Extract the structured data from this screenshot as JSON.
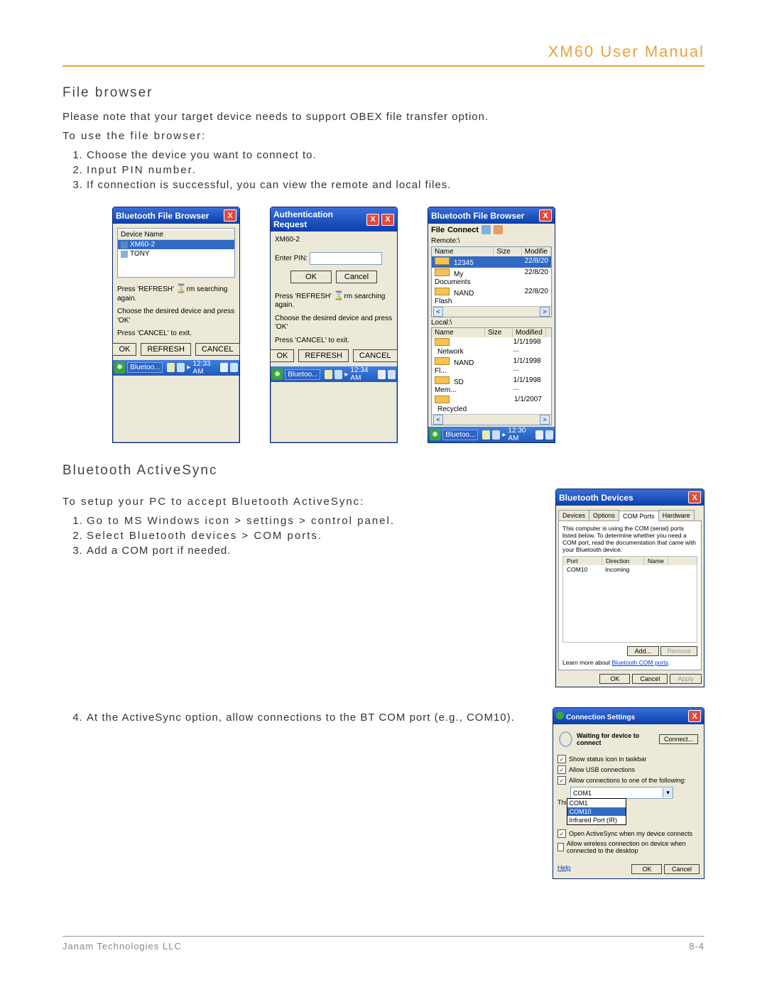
{
  "header": {
    "title": "XM60 User Manual"
  },
  "section1": {
    "heading": "File browser",
    "note": "Please note that your target device needs to support OBEX file transfer option.",
    "use_title": "To use the file browser:",
    "steps": [
      "Choose the device you want to connect to.",
      "Input PIN number.",
      "If connection is successful, you can view the remote and local files."
    ]
  },
  "win_a": {
    "title": "Bluetooth File Browser",
    "list_header": "Device Name",
    "items": [
      "XM60-2",
      "TONY"
    ],
    "msg1a": "Press 'REFRESH'",
    "msg1b": "rm searching",
    "msg1c": "again.",
    "msg2": "Choose the desired device and press 'OK'",
    "msg3": "Press 'CANCEL' to exit.",
    "ok": "OK",
    "refresh": "REFRESH",
    "cancel": "CANCEL",
    "taskbtn": "Bluetoo...",
    "time": "12:33 AM"
  },
  "win_b": {
    "title": "Authentication Request",
    "device": "XM60-2",
    "enter_pin": "Enter PIN:",
    "ok": "OK",
    "cancel": "Cancel",
    "msg1a": "Press 'REFRESH'",
    "msg1b": "rm searching",
    "msg1c": "again.",
    "msg2": "Choose the desired device and press 'OK'",
    "msg3": "Press 'CANCEL' to exit.",
    "ok2": "OK",
    "refresh": "REFRESH",
    "cancel2": "CANCEL",
    "taskbtn": "Bluetoo...",
    "time": "12:34 AM"
  },
  "win_c": {
    "title": "Bluetooth File Browser",
    "menu_file": "File",
    "menu_connect": "Connect",
    "remote_label": "Remote:\\",
    "remote_hdr": {
      "name": "Name",
      "size": "Size",
      "mod": "Modifie"
    },
    "remote_rows": [
      {
        "name": "12345",
        "mod": "22/8/20"
      },
      {
        "name": "My Documents",
        "mod": "22/8/20"
      },
      {
        "name": "NAND Flash",
        "mod": "22/8/20"
      }
    ],
    "local_label": "Local:\\",
    "local_hdr": {
      "name": "Name",
      "size": "Size",
      "mod": "Modified"
    },
    "local_rows": [
      {
        "name": "Network",
        "mod": "1/1/1998 ..."
      },
      {
        "name": "NAND Fl...",
        "mod": "1/1/1998 ..."
      },
      {
        "name": "SD Mem...",
        "mod": "1/1/1998 ..."
      },
      {
        "name": "Recycled",
        "mod": "1/1/2007"
      }
    ],
    "taskbtn": "Bluetoo...",
    "time": "12:30 AM"
  },
  "section2": {
    "heading": "Bluetooth ActiveSync",
    "intro": "To setup your PC to accept Bluetooth ActiveSync:",
    "steps": [
      "Go to MS Windows icon > settings > control panel.",
      "Select Bluetooth devices > COM ports.",
      "Add a COM port if needed."
    ],
    "step4": "At the ActiveSync option, allow connections to the BT COM port (e.g., COM10)."
  },
  "bt_devices": {
    "title": "Bluetooth Devices",
    "tabs": [
      "Devices",
      "Options",
      "COM Ports",
      "Hardware"
    ],
    "info": "This computer is using the COM (serial) ports listed below. To determine whether you need a COM port, read the documentation that came with your Bluetooth device.",
    "cols": {
      "port": "Port",
      "dir": "Direction",
      "name": "Name"
    },
    "row": {
      "port": "COM10",
      "dir": "Incoming"
    },
    "add": "Add...",
    "remove": "Remove",
    "learn": "Learn more about ",
    "learn_link": "Bluetooth COM ports",
    "ok": "OK",
    "cancel": "Cancel",
    "apply": "Apply"
  },
  "conn": {
    "title": "Connection Settings",
    "waiting": "Waiting for device to connect",
    "connect": "Connect...",
    "chk1": "Show status icon in taskbar",
    "chk2": "Allow USB connections",
    "chk3": "Allow connections to one of the following:",
    "combo_val": "COM1",
    "opts_prefix": "Thi",
    "opts": [
      "COM1",
      "COM10",
      "Infrared Port (IR)"
    ],
    "chk4": "Open ActiveSync when my device connects",
    "chk5": "Allow wireless connection on device when connected to the desktop",
    "help": "Help",
    "ok": "OK",
    "cancel": "Cancel"
  },
  "footer": {
    "company": "Janam Technologies LLC",
    "page": "8-4"
  }
}
